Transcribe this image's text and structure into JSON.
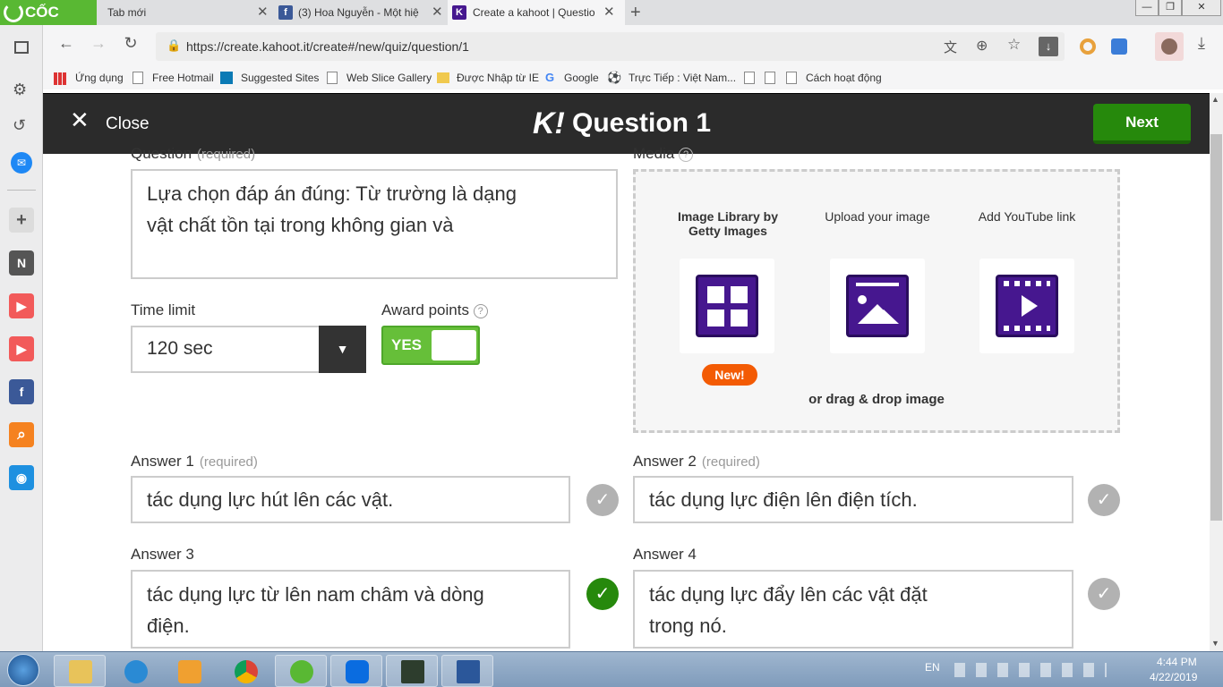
{
  "browser": {
    "brand": "CỐC CỐC",
    "tabs": [
      {
        "label": "Tab mới"
      },
      {
        "label": "(3) Hoa Nguyễn - Một hiệ"
      },
      {
        "label": "Create a kahoot | Questio"
      }
    ],
    "new_tab": "+",
    "url": "https://create.kahoot.it/create#/new/quiz/question/1",
    "bookmarks": [
      {
        "label": "Ứng dụng"
      },
      {
        "label": "Free Hotmail"
      },
      {
        "label": "Suggested Sites"
      },
      {
        "label": "Web Slice Gallery"
      },
      {
        "label": "Được Nhập từ IE"
      },
      {
        "label": "Google"
      },
      {
        "label": "Trực Tiếp : Việt Nam..."
      },
      {
        "label": "Cách hoạt động"
      }
    ]
  },
  "header": {
    "close_label": "Close",
    "logo": "K!",
    "title": "Question 1",
    "next_label": "Next"
  },
  "question": {
    "label": "Question",
    "required": "(required)",
    "text": "Lựa chọn đáp án đúng: Từ trường là dạng vật chất tồn tại trong không gian và"
  },
  "time_limit": {
    "label": "Time limit",
    "value": "120 sec"
  },
  "award_points": {
    "label": "Award points",
    "value": "YES"
  },
  "media": {
    "label": "Media",
    "options": [
      {
        "label": "Image Library by Getty Images"
      },
      {
        "label": "Upload your image"
      },
      {
        "label": "Add YouTube link"
      }
    ],
    "badge": "New!",
    "drag_text": "or drag & drop image"
  },
  "answers": [
    {
      "label": "Answer 1",
      "required": "(required)",
      "text": "tác dụng lực hút lên các vật.",
      "correct": false
    },
    {
      "label": "Answer 2",
      "required": "(required)",
      "text": "tác dụng lực điện lên điện tích.",
      "correct": false
    },
    {
      "label": "Answer 3",
      "required": "",
      "text": "tác dụng lực từ lên nam châm và dòng điện.",
      "correct": true
    },
    {
      "label": "Answer 4",
      "required": "",
      "text": "tác dụng lực đẩy lên các vật đặt trong nó.",
      "correct": false
    }
  ],
  "taskbar": {
    "lang": "EN",
    "time": "4:44 PM",
    "date": "4/22/2019"
  },
  "colors": {
    "next": "#26890c",
    "purple": "#46178f",
    "badge": "#f35b04",
    "header": "#2b2b2b"
  }
}
